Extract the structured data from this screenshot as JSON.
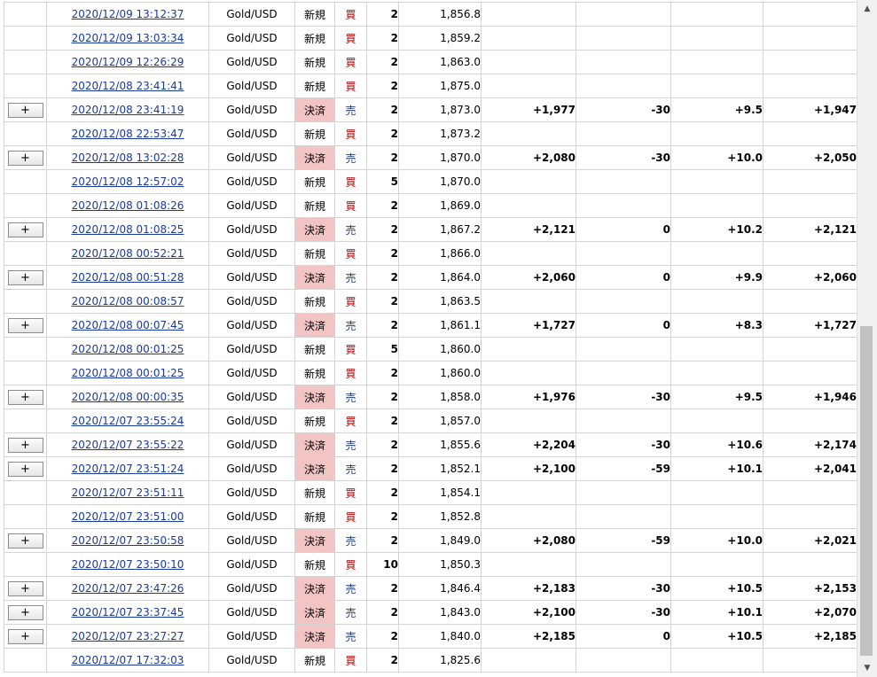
{
  "scrollbar": {
    "up_icon": "▲",
    "down_icon": "▼"
  },
  "rows": [
    {
      "btn": "",
      "date": "2020/12/09 13:12:37",
      "symbol": "Gold/USD",
      "type": "新規",
      "settle": false,
      "side": "買",
      "qty": "2",
      "price": "1,856.8",
      "c1": "",
      "c2": "",
      "c3": "",
      "c4": ""
    },
    {
      "btn": "",
      "date": "2020/12/09 13:03:34",
      "symbol": "Gold/USD",
      "type": "新規",
      "settle": false,
      "side": "買",
      "qty": "2",
      "price": "1,859.2",
      "c1": "",
      "c2": "",
      "c3": "",
      "c4": ""
    },
    {
      "btn": "",
      "date": "2020/12/09 12:26:29",
      "symbol": "Gold/USD",
      "type": "新規",
      "settle": false,
      "side": "買",
      "qty": "2",
      "price": "1,863.0",
      "c1": "",
      "c2": "",
      "c3": "",
      "c4": ""
    },
    {
      "btn": "",
      "date": "2020/12/08 23:41:41",
      "symbol": "Gold/USD",
      "type": "新規",
      "settle": false,
      "side": "買",
      "qty": "2",
      "price": "1,875.0",
      "c1": "",
      "c2": "",
      "c3": "",
      "c4": ""
    },
    {
      "btn": "+",
      "date": "2020/12/08 23:41:19",
      "symbol": "Gold/USD",
      "type": "決済",
      "settle": true,
      "side": "売",
      "qty": "2",
      "price": "1,873.0",
      "c1": "+1,977",
      "c2": "-30",
      "c3": "+9.5",
      "c4": "+1,947"
    },
    {
      "btn": "",
      "date": "2020/12/08 22:53:47",
      "symbol": "Gold/USD",
      "type": "新規",
      "settle": false,
      "side": "買",
      "qty": "2",
      "price": "1,873.2",
      "c1": "",
      "c2": "",
      "c3": "",
      "c4": ""
    },
    {
      "btn": "+",
      "date": "2020/12/08 13:02:28",
      "symbol": "Gold/USD",
      "type": "決済",
      "settle": true,
      "side": "売",
      "qty": "2",
      "price": "1,870.0",
      "c1": "+2,080",
      "c2": "-30",
      "c3": "+10.0",
      "c4": "+2,050"
    },
    {
      "btn": "",
      "date": "2020/12/08 12:57:02",
      "symbol": "Gold/USD",
      "type": "新規",
      "settle": false,
      "side": "買",
      "qty": "5",
      "price": "1,870.0",
      "c1": "",
      "c2": "",
      "c3": "",
      "c4": ""
    },
    {
      "btn": "",
      "date": "2020/12/08 01:08:26",
      "symbol": "Gold/USD",
      "type": "新規",
      "settle": false,
      "side": "買",
      "qty": "2",
      "price": "1,869.0",
      "c1": "",
      "c2": "",
      "c3": "",
      "c4": ""
    },
    {
      "btn": "+",
      "date": "2020/12/08 01:08:25",
      "symbol": "Gold/USD",
      "type": "決済",
      "settle": true,
      "side": "売",
      "qty": "2",
      "price": "1,867.2",
      "c1": "+2,121",
      "c2": "0",
      "c3": "+10.2",
      "c4": "+2,121"
    },
    {
      "btn": "",
      "date": "2020/12/08 00:52:21",
      "symbol": "Gold/USD",
      "type": "新規",
      "settle": false,
      "side": "買",
      "qty": "2",
      "price": "1,866.0",
      "c1": "",
      "c2": "",
      "c3": "",
      "c4": ""
    },
    {
      "btn": "+",
      "date": "2020/12/08 00:51:28",
      "symbol": "Gold/USD",
      "type": "決済",
      "settle": true,
      "side": "売",
      "qty": "2",
      "price": "1,864.0",
      "c1": "+2,060",
      "c2": "0",
      "c3": "+9.9",
      "c4": "+2,060"
    },
    {
      "btn": "",
      "date": "2020/12/08 00:08:57",
      "symbol": "Gold/USD",
      "type": "新規",
      "settle": false,
      "side": "買",
      "qty": "2",
      "price": "1,863.5",
      "c1": "",
      "c2": "",
      "c3": "",
      "c4": ""
    },
    {
      "btn": "+",
      "date": "2020/12/08 00:07:45",
      "symbol": "Gold/USD",
      "type": "決済",
      "settle": true,
      "side": "売",
      "qty": "2",
      "price": "1,861.1",
      "c1": "+1,727",
      "c2": "0",
      "c3": "+8.3",
      "c4": "+1,727"
    },
    {
      "btn": "",
      "date": "2020/12/08 00:01:25",
      "symbol": "Gold/USD",
      "type": "新規",
      "settle": false,
      "side": "買",
      "qty": "5",
      "price": "1,860.0",
      "c1": "",
      "c2": "",
      "c3": "",
      "c4": ""
    },
    {
      "btn": "",
      "date": "2020/12/08 00:01:25",
      "symbol": "Gold/USD",
      "type": "新規",
      "settle": false,
      "side": "買",
      "qty": "2",
      "price": "1,860.0",
      "c1": "",
      "c2": "",
      "c3": "",
      "c4": ""
    },
    {
      "btn": "+",
      "date": "2020/12/08 00:00:35",
      "symbol": "Gold/USD",
      "type": "決済",
      "settle": true,
      "side": "売",
      "qty": "2",
      "price": "1,858.0",
      "c1": "+1,976",
      "c2": "-30",
      "c3": "+9.5",
      "c4": "+1,946"
    },
    {
      "btn": "",
      "date": "2020/12/07 23:55:24",
      "symbol": "Gold/USD",
      "type": "新規",
      "settle": false,
      "side": "買",
      "qty": "2",
      "price": "1,857.0",
      "c1": "",
      "c2": "",
      "c3": "",
      "c4": ""
    },
    {
      "btn": "+",
      "date": "2020/12/07 23:55:22",
      "symbol": "Gold/USD",
      "type": "決済",
      "settle": true,
      "side": "売",
      "qty": "2",
      "price": "1,855.6",
      "c1": "+2,204",
      "c2": "-30",
      "c3": "+10.6",
      "c4": "+2,174"
    },
    {
      "btn": "+",
      "date": "2020/12/07 23:51:24",
      "symbol": "Gold/USD",
      "type": "決済",
      "settle": true,
      "side": "売",
      "qty": "2",
      "price": "1,852.1",
      "c1": "+2,100",
      "c2": "-59",
      "c3": "+10.1",
      "c4": "+2,041"
    },
    {
      "btn": "",
      "date": "2020/12/07 23:51:11",
      "symbol": "Gold/USD",
      "type": "新規",
      "settle": false,
      "side": "買",
      "qty": "2",
      "price": "1,854.1",
      "c1": "",
      "c2": "",
      "c3": "",
      "c4": ""
    },
    {
      "btn": "",
      "date": "2020/12/07 23:51:00",
      "symbol": "Gold/USD",
      "type": "新規",
      "settle": false,
      "side": "買",
      "qty": "2",
      "price": "1,852.8",
      "c1": "",
      "c2": "",
      "c3": "",
      "c4": ""
    },
    {
      "btn": "+",
      "date": "2020/12/07 23:50:58",
      "symbol": "Gold/USD",
      "type": "決済",
      "settle": true,
      "side": "売",
      "qty": "2",
      "price": "1,849.0",
      "c1": "+2,080",
      "c2": "-59",
      "c3": "+10.0",
      "c4": "+2,021"
    },
    {
      "btn": "",
      "date": "2020/12/07 23:50:10",
      "symbol": "Gold/USD",
      "type": "新規",
      "settle": false,
      "side": "買",
      "qty": "10",
      "price": "1,850.3",
      "c1": "",
      "c2": "",
      "c3": "",
      "c4": ""
    },
    {
      "btn": "+",
      "date": "2020/12/07 23:47:26",
      "symbol": "Gold/USD",
      "type": "決済",
      "settle": true,
      "side": "売",
      "qty": "2",
      "price": "1,846.4",
      "c1": "+2,183",
      "c2": "-30",
      "c3": "+10.5",
      "c4": "+2,153"
    },
    {
      "btn": "+",
      "date": "2020/12/07 23:37:45",
      "symbol": "Gold/USD",
      "type": "決済",
      "settle": true,
      "side": "売",
      "qty": "2",
      "price": "1,843.0",
      "c1": "+2,100",
      "c2": "-30",
      "c3": "+10.1",
      "c4": "+2,070"
    },
    {
      "btn": "+",
      "date": "2020/12/07 23:27:27",
      "symbol": "Gold/USD",
      "type": "決済",
      "settle": true,
      "side": "売",
      "qty": "2",
      "price": "1,840.0",
      "c1": "+2,185",
      "c2": "0",
      "c3": "+10.5",
      "c4": "+2,185"
    },
    {
      "btn": "",
      "date": "2020/12/07 17:32:03",
      "symbol": "Gold/USD",
      "type": "新規",
      "settle": false,
      "side": "買",
      "qty": "2",
      "price": "1,825.6",
      "c1": "",
      "c2": "",
      "c3": "",
      "c4": ""
    }
  ]
}
